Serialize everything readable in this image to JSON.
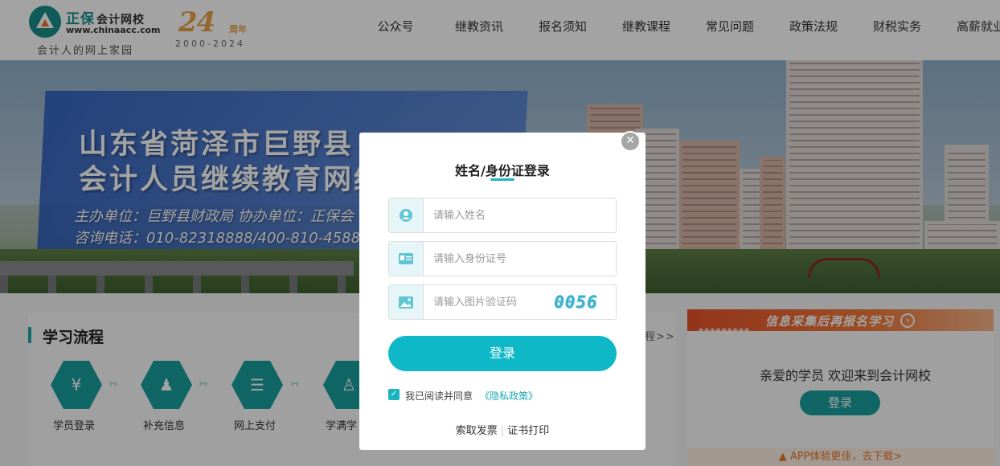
{
  "header": {
    "brand_main": "正保",
    "brand_sub": "会计网校",
    "brand_url": "www.chinaacc.com",
    "slogan": "会计人的网上家园",
    "anniversary_number": "24",
    "anniversary_label": "周年",
    "anniversary_years": "2000-2024",
    "nav_items": [
      "公众号",
      "继教资讯",
      "报名须知",
      "继教课程",
      "常见问题",
      "政策法规",
      "财税实务",
      "高薪就业"
    ]
  },
  "banner": {
    "title_line1": "山东省菏泽市巨野县",
    "title_line2": "会计人员继续教育网络",
    "organizer": "主办单位：巨野县财政局 协办单位：正保会",
    "hotline": "咨询电话：010-82318888/400-810-4588"
  },
  "section": {
    "title": "学习流程",
    "more": "程>>",
    "steps": [
      {
        "label": "学员登录",
        "icon": "money-bag-icon",
        "glyph": "¥"
      },
      {
        "label": "补充信息",
        "icon": "user-check-icon",
        "glyph": "♟"
      },
      {
        "label": "网上支付",
        "icon": "clipboard-icon",
        "glyph": "☰"
      },
      {
        "label": "学满学",
        "icon": "id-card-icon",
        "glyph": "♙"
      }
    ]
  },
  "sidebar": {
    "banner_text": "信息采集后再报名学习",
    "banner_arrow": "›",
    "welcome": "亲爱的学员 欢迎来到会计网校",
    "login_label": "登录",
    "app_text": "APP体验更佳，去下载>"
  },
  "modal": {
    "close_glyph": "✕",
    "title": "姓名/身份证登录",
    "name_placeholder": "请输入姓名",
    "id_placeholder": "请输入身份证号",
    "captcha_placeholder": "请输入图片验证码",
    "captcha_text": "0056",
    "login_label": "登录",
    "agree_text": "我已阅读并同意",
    "privacy_link": "《隐私政策》",
    "footer_invoice": "索取发票",
    "footer_separator": "|",
    "footer_certificate": "证书打印"
  },
  "colors": {
    "accent": "#0fb8c6",
    "teal": "#1a9f9f",
    "orange": "#e8532a"
  }
}
